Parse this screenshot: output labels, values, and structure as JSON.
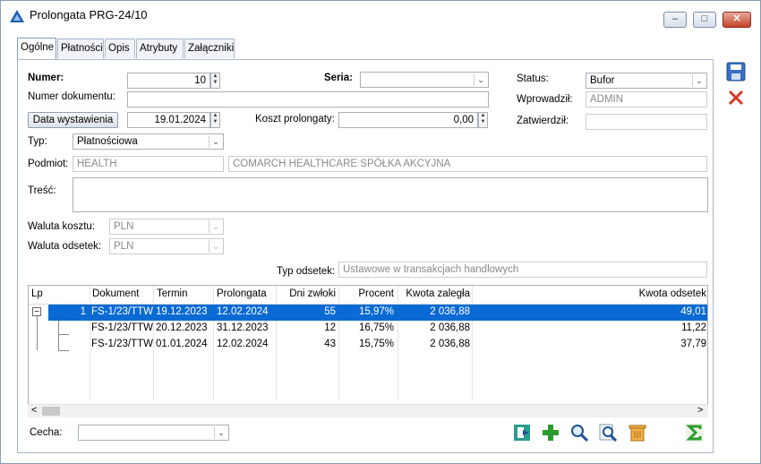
{
  "window": {
    "title": "Prolongata PRG-24/10",
    "minimize": "–",
    "maximize": "□",
    "close": "✕"
  },
  "tabs": [
    {
      "label": "Ogólne"
    },
    {
      "label": "Płatności"
    },
    {
      "label": "Opis"
    },
    {
      "label": "Atrybuty"
    },
    {
      "label": "Załączniki"
    }
  ],
  "form": {
    "numer_label": "Numer:",
    "numer_value": "10",
    "seria_label": "Seria:",
    "seria_value": "",
    "status_label": "Status:",
    "status_value": "Bufor",
    "numer_dokumentu_label": "Numer dokumentu:",
    "numer_dokumentu_value": "",
    "wprowadzil_label": "Wprowadził:",
    "wprowadzil_value": "ADMIN",
    "data_button": "Data wystawienia",
    "data_value": "19.01.2024",
    "koszt_label": "Koszt prolongaty:",
    "koszt_value": "0,00",
    "zatwierdzil_label": "Zatwierdził:",
    "zatwierdzil_value": "",
    "typ_label": "Typ:",
    "typ_value": "Płatnościowa",
    "podmiot_label": "Podmiot:",
    "podmiot_code": "HEALTH",
    "podmiot_name": "COMARCH HEALTHCARE SPÓŁKA AKCYJNA",
    "tresc_label": "Treść:",
    "tresc_value": "",
    "waluta_kosztu_label": "Waluta kosztu:",
    "waluta_kosztu_value": "PLN",
    "waluta_odsetek_label": "Waluta odsetek:",
    "waluta_odsetek_value": "PLN",
    "typ_odsetek_label": "Typ odsetek:",
    "typ_odsetek_value": "Ustawowe w transakcjach handlowych",
    "cecha_label": "Cecha:",
    "cecha_value": ""
  },
  "table": {
    "headers": [
      "Lp",
      "Dokument",
      "Termin",
      "Prolongata",
      "Dni zwłoki",
      "Procent",
      "Kwota zaległa",
      "Kwota odsetek"
    ],
    "rows": [
      {
        "lp": "1",
        "dokument": "FS-1/23/TTW",
        "termin": "19.12.2023",
        "prolongata": "12.02.2024",
        "dni": "55",
        "procent": "15,97%",
        "kwota": "2 036,88",
        "odsetki": "49,01"
      },
      {
        "lp": "",
        "dokument": "FS-1/23/TTW",
        "termin": "20.12.2023",
        "prolongata": "31.12.2023",
        "dni": "12",
        "procent": "16,75%",
        "kwota": "2 036,88",
        "odsetki": "11,22"
      },
      {
        "lp": "",
        "dokument": "FS-1/23/TTW",
        "termin": "01.01.2024",
        "prolongata": "12.02.2024",
        "dni": "43",
        "procent": "15,75%",
        "kwota": "2 036,88",
        "odsetki": "37,79"
      }
    ],
    "expander": "−",
    "scroll_left": "<",
    "scroll_right": ">"
  },
  "colors": {
    "selection": "#0a6ad3",
    "add": "#2e9b2e",
    "delete": "#d9352a",
    "save": "#3a6fc4"
  }
}
